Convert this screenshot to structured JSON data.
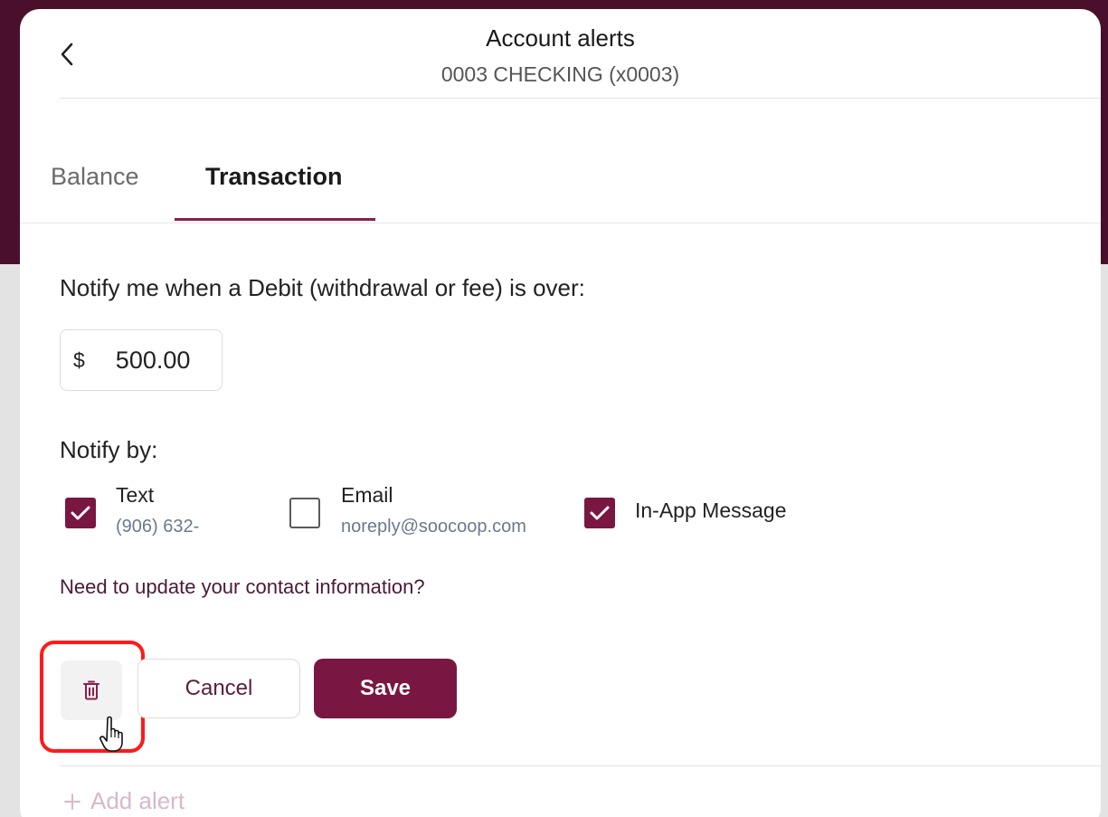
{
  "header": {
    "title": "Account alerts",
    "subtitle": "0003 CHECKING (x0003)"
  },
  "tabs": [
    {
      "label": "Balance",
      "active": false
    },
    {
      "label": "Transaction",
      "active": true
    }
  ],
  "form": {
    "prompt": "Notify me when a Debit (withdrawal or fee) is over:",
    "currency_symbol": "$",
    "amount": "500.00",
    "notify_by_label": "Notify by:",
    "options": [
      {
        "label": "Text",
        "sub": "(906) 632-",
        "checked": true
      },
      {
        "label": "Email",
        "sub": "noreply@soocoop.com",
        "checked": false
      },
      {
        "label": "In-App Message",
        "sub": "",
        "checked": true
      }
    ],
    "contact_link": "Need to update your contact information?"
  },
  "actions": {
    "delete_icon": "trash-icon",
    "cancel_label": "Cancel",
    "save_label": "Save"
  },
  "footer": {
    "add_alert_label": "Add alert"
  },
  "colors": {
    "brand": "#7a1642",
    "background_top": "#4a0f2a",
    "highlight": "#ff1a1a"
  }
}
